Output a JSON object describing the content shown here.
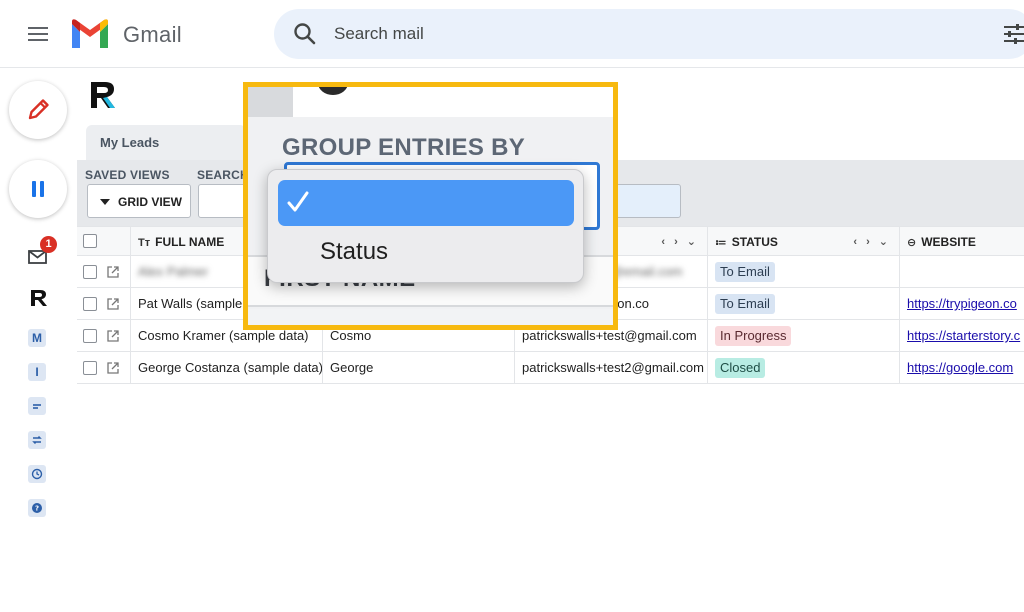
{
  "header": {
    "app_name": "Gmail",
    "search_placeholder": "Search mail"
  },
  "rail": {
    "inbox_badge": "1",
    "items": [
      "M",
      "I"
    ]
  },
  "app": {
    "tab": "My Leads",
    "toolbar": {
      "saved_views_label": "SAVED VIEWS",
      "search_label": "SEARCH",
      "grid_view_label": "GRID VIEW"
    },
    "columns": [
      {
        "label": "FULL NAME",
        "icon": "text-type-icon"
      },
      {
        "label": "STATUS",
        "icon": "list-icon"
      },
      {
        "label": "WEBSITE",
        "icon": "link-icon"
      }
    ],
    "col_controls": "‹ › ⌄",
    "rows": [
      {
        "full_name": "Alex Palmer",
        "first_name": "",
        "email": "pat@email.com",
        "status": "To Email",
        "status_kind": "email",
        "website": ""
      },
      {
        "full_name": "Pat Walls (sample",
        "first_name": "",
        "email": "eon.co",
        "status": "To Email",
        "status_kind": "email",
        "website": "https://trypigeon.co"
      },
      {
        "full_name": "Cosmo Kramer (sample data)",
        "first_name": "Cosmo",
        "email": "patrickswalls+test@gmail.com",
        "status": "In Progress",
        "status_kind": "progress",
        "website": "https://starterstory.c"
      },
      {
        "full_name": "George Costanza (sample data)",
        "first_name": "George",
        "email": "patrickswalls+test2@gmail.com",
        "status": "Closed",
        "status_kind": "closed",
        "website": "https://google.com"
      }
    ]
  },
  "zoom": {
    "title": "GROUP ENTRIES BY",
    "column_label": "FIRST NAME",
    "options": [
      {
        "label": "",
        "selected": true
      },
      {
        "label": "Status",
        "selected": false
      }
    ]
  },
  "colors": {
    "highlight_border": "#f7b90f",
    "selected_option": "#4b98f6",
    "select_border": "#2f78d4"
  }
}
